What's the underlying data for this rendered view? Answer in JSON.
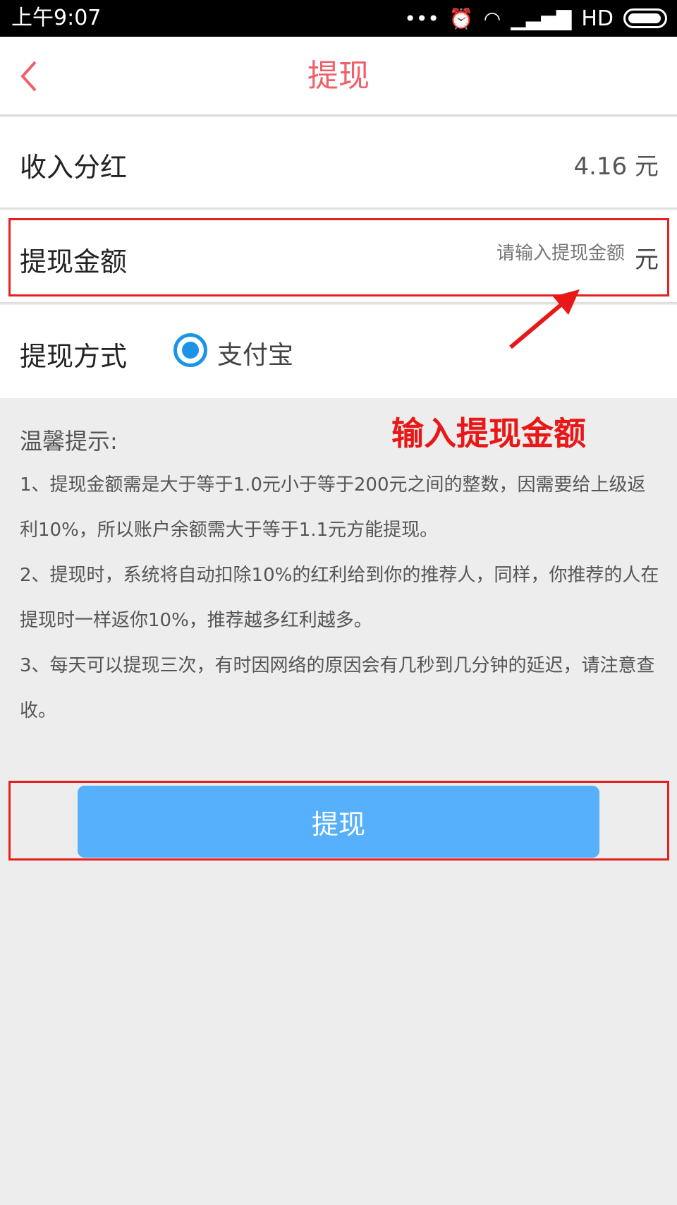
{
  "status_bar": {
    "time": "上午9:07",
    "icons": [
      "more-dots-icon",
      "alarm-icon",
      "wifi-icon",
      "signal-icon",
      "battery-icon"
    ],
    "network": "HD"
  },
  "header": {
    "title": "提现",
    "back_icon": "chevron-left-icon"
  },
  "income": {
    "label": "收入分红",
    "value": "4.16 元"
  },
  "amount": {
    "label": "提现金额",
    "placeholder": "请输入提现金额",
    "value": "",
    "unit": "元"
  },
  "method": {
    "label": "提现方式",
    "options": [
      {
        "label": "支付宝",
        "selected": true
      }
    ]
  },
  "annotation": {
    "text": "输入提现金额",
    "color": "#e52020"
  },
  "tips": {
    "title": "温馨提示:",
    "items": [
      "1、提现金额需是大于等于1.0元小于等于200元之间的整数，因需要给上级返利10%，所以账户余额需大于等于1.1元方能提现。",
      "2、提现时，系统将自动扣除10%的红利给到你的推荐人，同样，你推荐的人在提现时一样返你10%，推荐越多红利越多。",
      "3、每天可以提现三次，有时因网络的原因会有几秒到几分钟的延迟，请注意查收。"
    ]
  },
  "submit": {
    "label": "提现",
    "color": "#56b0fb"
  },
  "colors": {
    "title": "#f0606a",
    "radio": "#1a93e8",
    "page_bg": "#ededed"
  }
}
